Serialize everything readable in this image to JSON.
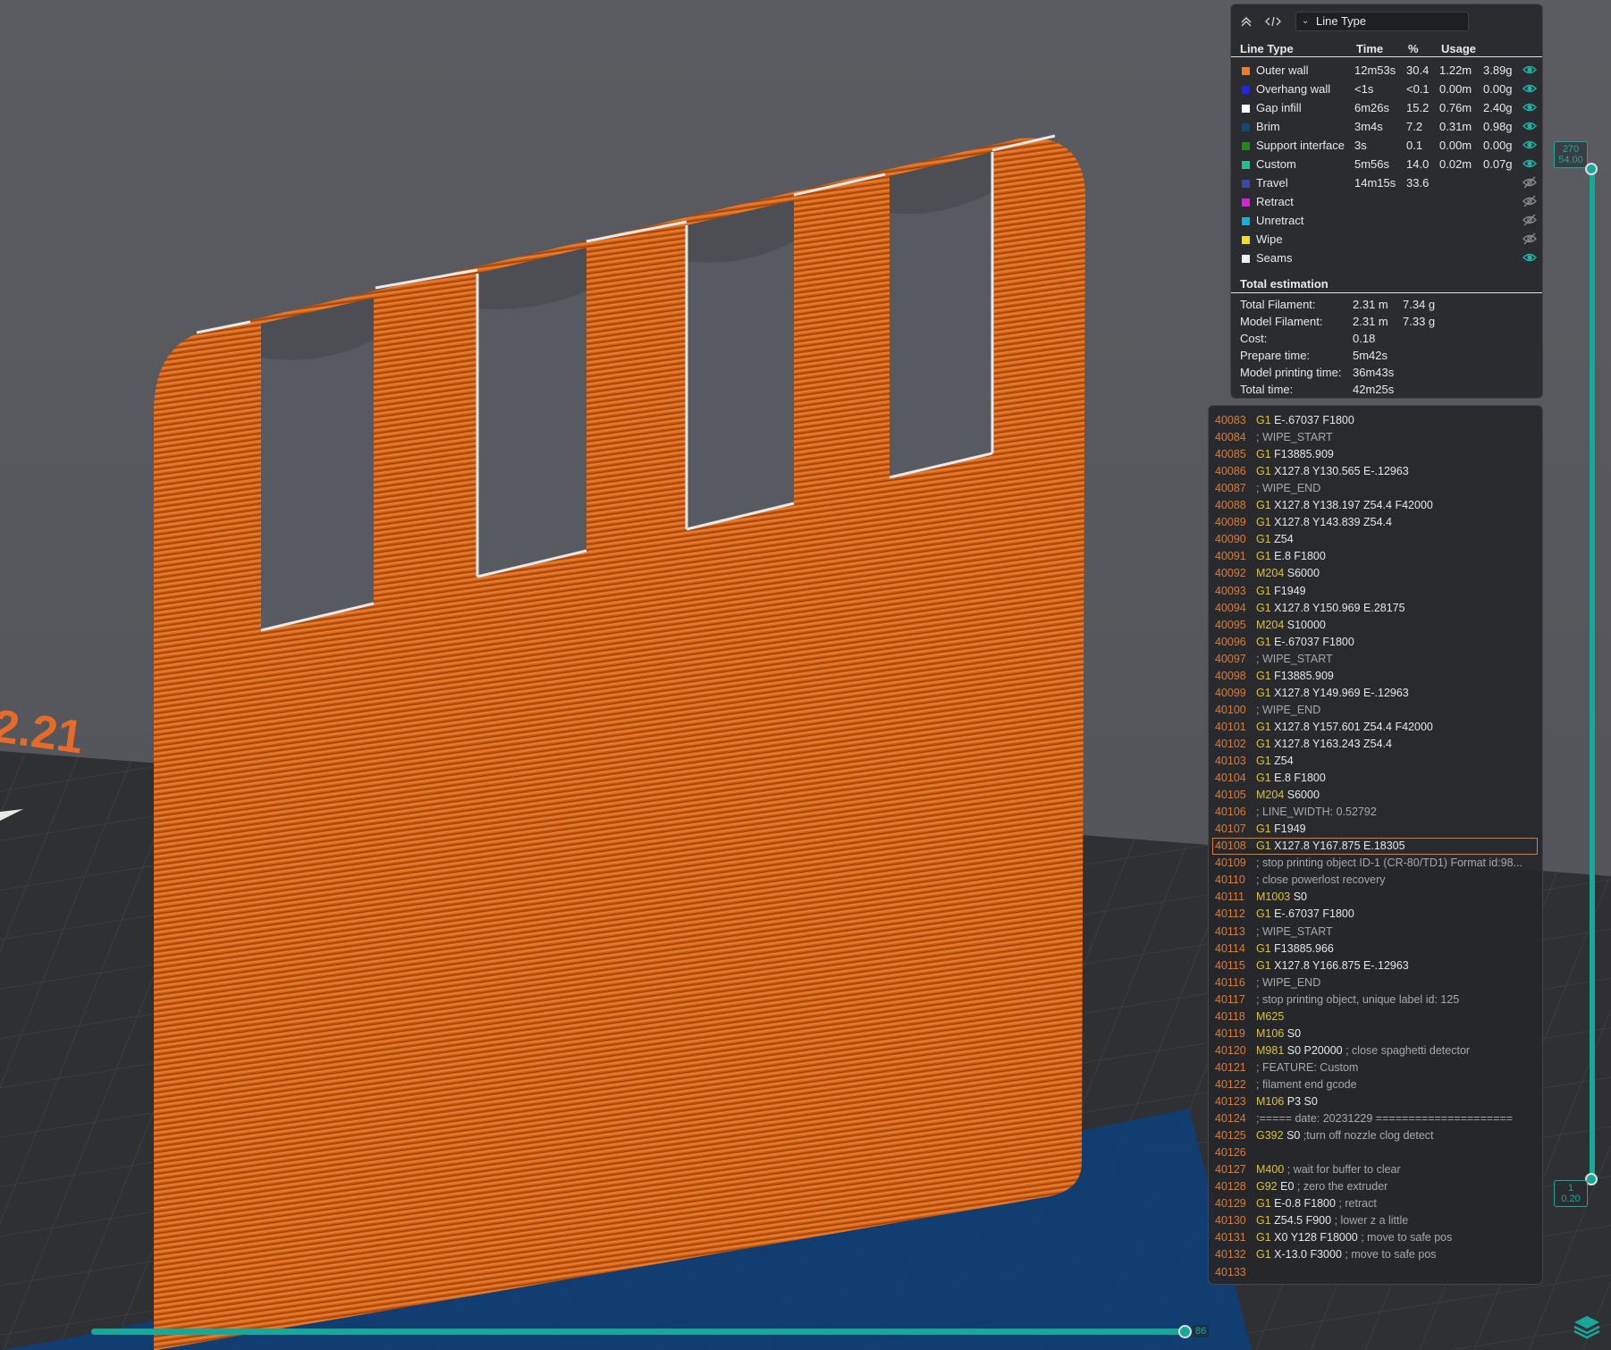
{
  "legend": {
    "dropdown_label": "Line Type",
    "headers": {
      "line_type": "Line Type",
      "time": "Time",
      "percent": "%",
      "usage": "Usage"
    },
    "rows": [
      {
        "name": "Outer wall",
        "time": "12m53s",
        "percent": "30.4",
        "usage_len": "1.22m",
        "usage_wt": "3.89g",
        "color": "#ee7a2a",
        "visible": true
      },
      {
        "name": "Overhang wall",
        "time": "<1s",
        "percent": "<0.1",
        "usage_len": "0.00m",
        "usage_wt": "0.00g",
        "color": "#2222ee",
        "visible": true
      },
      {
        "name": "Gap infill",
        "time": "6m26s",
        "percent": "15.2",
        "usage_len": "0.76m",
        "usage_wt": "2.40g",
        "color": "#ffffff",
        "visible": true
      },
      {
        "name": "Brim",
        "time": "3m4s",
        "percent": "7.2",
        "usage_len": "0.31m",
        "usage_wt": "0.98g",
        "color": "#0d4a7a",
        "visible": true
      },
      {
        "name": "Support interface",
        "time": "3s",
        "percent": "0.1",
        "usage_len": "0.00m",
        "usage_wt": "0.00g",
        "color": "#1e8a1e",
        "visible": true
      },
      {
        "name": "Custom",
        "time": "5m56s",
        "percent": "14.0",
        "usage_len": "0.02m",
        "usage_wt": "0.07g",
        "color": "#22c08a",
        "visible": true
      },
      {
        "name": "Travel",
        "time": "14m15s",
        "percent": "33.6",
        "usage_len": "",
        "usage_wt": "",
        "color": "#3a4aa8",
        "visible": false
      },
      {
        "name": "Retract",
        "time": "",
        "percent": "",
        "usage_len": "",
        "usage_wt": "",
        "color": "#e01ee0",
        "visible": false
      },
      {
        "name": "Unretract",
        "time": "",
        "percent": "",
        "usage_len": "",
        "usage_wt": "",
        "color": "#12b0d8",
        "visible": false
      },
      {
        "name": "Wipe",
        "time": "",
        "percent": "",
        "usage_len": "",
        "usage_wt": "",
        "color": "#f0e020",
        "visible": false
      },
      {
        "name": "Seams",
        "time": "",
        "percent": "",
        "usage_len": "",
        "usage_wt": "",
        "color": "#f0f0f0",
        "visible": true
      }
    ],
    "total_title": "Total estimation",
    "totals": [
      {
        "label": "Total Filament:",
        "v1": "2.31 m",
        "v2": "7.34 g"
      },
      {
        "label": "Model Filament:",
        "v1": "2.31 m",
        "v2": "7.33 g"
      },
      {
        "label": "Cost:",
        "v1": "0.18",
        "v2": ""
      },
      {
        "label": "Prepare time:",
        "v1": "5m42s",
        "v2": ""
      },
      {
        "label": "Model printing time:",
        "v1": "36m43s",
        "v2": ""
      },
      {
        "label": "Total time:",
        "v1": "42m25s",
        "v2": ""
      }
    ]
  },
  "gcode": {
    "selected_line": "40108",
    "lines": [
      {
        "n": "40083",
        "cmd": "G1",
        "rest": " E-.67037 F1800",
        "comment": ""
      },
      {
        "n": "40084",
        "cmd": "",
        "rest": "",
        "comment": "; WIPE_START"
      },
      {
        "n": "40085",
        "cmd": "G1",
        "rest": " F13885.909",
        "comment": ""
      },
      {
        "n": "40086",
        "cmd": "G1",
        "rest": " X127.8 Y130.565 E-.12963",
        "comment": ""
      },
      {
        "n": "40087",
        "cmd": "",
        "rest": "",
        "comment": "; WIPE_END"
      },
      {
        "n": "40088",
        "cmd": "G1",
        "rest": " X127.8 Y138.197 Z54.4 F42000",
        "comment": ""
      },
      {
        "n": "40089",
        "cmd": "G1",
        "rest": " X127.8 Y143.839 Z54.4",
        "comment": ""
      },
      {
        "n": "40090",
        "cmd": "G1",
        "rest": " Z54",
        "comment": ""
      },
      {
        "n": "40091",
        "cmd": "G1",
        "rest": " E.8 F1800",
        "comment": ""
      },
      {
        "n": "40092",
        "cmd": "M204",
        "rest": " S6000",
        "comment": ""
      },
      {
        "n": "40093",
        "cmd": "G1",
        "rest": " F1949",
        "comment": ""
      },
      {
        "n": "40094",
        "cmd": "G1",
        "rest": " X127.8 Y150.969 E.28175",
        "comment": ""
      },
      {
        "n": "40095",
        "cmd": "M204",
        "rest": " S10000",
        "comment": ""
      },
      {
        "n": "40096",
        "cmd": "G1",
        "rest": " E-.67037 F1800",
        "comment": ""
      },
      {
        "n": "40097",
        "cmd": "",
        "rest": "",
        "comment": "; WIPE_START"
      },
      {
        "n": "40098",
        "cmd": "G1",
        "rest": " F13885.909",
        "comment": ""
      },
      {
        "n": "40099",
        "cmd": "G1",
        "rest": " X127.8 Y149.969 E-.12963",
        "comment": ""
      },
      {
        "n": "40100",
        "cmd": "",
        "rest": "",
        "comment": "; WIPE_END"
      },
      {
        "n": "40101",
        "cmd": "G1",
        "rest": " X127.8 Y157.601 Z54.4 F42000",
        "comment": ""
      },
      {
        "n": "40102",
        "cmd": "G1",
        "rest": " X127.8 Y163.243 Z54.4",
        "comment": ""
      },
      {
        "n": "40103",
        "cmd": "G1",
        "rest": " Z54",
        "comment": ""
      },
      {
        "n": "40104",
        "cmd": "G1",
        "rest": " E.8 F1800",
        "comment": ""
      },
      {
        "n": "40105",
        "cmd": "M204",
        "rest": " S6000",
        "comment": ""
      },
      {
        "n": "40106",
        "cmd": "",
        "rest": "",
        "comment": "; LINE_WIDTH: 0.52792"
      },
      {
        "n": "40107",
        "cmd": "G1",
        "rest": " F1949",
        "comment": ""
      },
      {
        "n": "40108",
        "cmd": "G1",
        "rest": " X127.8 Y167.875 E.18305",
        "comment": ""
      },
      {
        "n": "40109",
        "cmd": "",
        "rest": "",
        "comment": "; stop printing object ID-1 (CR-80/TD1) Format id:98..."
      },
      {
        "n": "40110",
        "cmd": "",
        "rest": "",
        "comment": "; close powerlost recovery"
      },
      {
        "n": "40111",
        "cmd": "M1003",
        "rest": " S0",
        "comment": ""
      },
      {
        "n": "40112",
        "cmd": "G1",
        "rest": " E-.67037 F1800",
        "comment": ""
      },
      {
        "n": "40113",
        "cmd": "",
        "rest": "",
        "comment": "; WIPE_START"
      },
      {
        "n": "40114",
        "cmd": "G1",
        "rest": " F13885.966",
        "comment": ""
      },
      {
        "n": "40115",
        "cmd": "G1",
        "rest": " X127.8 Y166.875 E-.12963",
        "comment": ""
      },
      {
        "n": "40116",
        "cmd": "",
        "rest": "",
        "comment": "; WIPE_END"
      },
      {
        "n": "40117",
        "cmd": "",
        "rest": "",
        "comment": "; stop printing object, unique label id: 125"
      },
      {
        "n": "40118",
        "cmd": "M625",
        "rest": "",
        "comment": ""
      },
      {
        "n": "40119",
        "cmd": "M106",
        "rest": " S0",
        "comment": ""
      },
      {
        "n": "40120",
        "cmd": "M981",
        "rest": " S0 P20000",
        "comment": " ; close spaghetti detector"
      },
      {
        "n": "40121",
        "cmd": "",
        "rest": "",
        "comment": "; FEATURE: Custom"
      },
      {
        "n": "40122",
        "cmd": "",
        "rest": "",
        "comment": "; filament end gcode"
      },
      {
        "n": "40123",
        "cmd": "M106",
        "rest": " P3 S0",
        "comment": ""
      },
      {
        "n": "40124",
        "cmd": "",
        "rest": "",
        "comment": ";===== date: 20231229 ====================="
      },
      {
        "n": "40125",
        "cmd": "G392",
        "rest": " S0",
        "comment": " ;turn off nozzle clog detect"
      },
      {
        "n": "40126",
        "cmd": "",
        "rest": "",
        "comment": ""
      },
      {
        "n": "40127",
        "cmd": "M400",
        "rest": "",
        "comment": " ; wait for buffer to clear"
      },
      {
        "n": "40128",
        "cmd": "G92",
        "rest": " E0",
        "comment": " ; zero the extruder"
      },
      {
        "n": "40129",
        "cmd": "G1",
        "rest": " E-0.8 F1800",
        "comment": " ; retract"
      },
      {
        "n": "40130",
        "cmd": "G1",
        "rest": " Z54.5 F900",
        "comment": " ; lower z a little"
      },
      {
        "n": "40131",
        "cmd": "G1",
        "rest": " X0 Y128 F18000",
        "comment": " ; move to safe pos"
      },
      {
        "n": "40132",
        "cmd": "G1",
        "rest": " X-13.0 F3000",
        "comment": " ; move to safe pos"
      },
      {
        "n": "40133",
        "cmd": "",
        "rest": "",
        "comment": ""
      }
    ]
  },
  "vslider": {
    "top_layer": "270",
    "top_height": "54.00",
    "bottom_layer": "1",
    "bottom_height": "0.20"
  },
  "hslider": {
    "value": "86"
  },
  "plate_text": "2.21"
}
